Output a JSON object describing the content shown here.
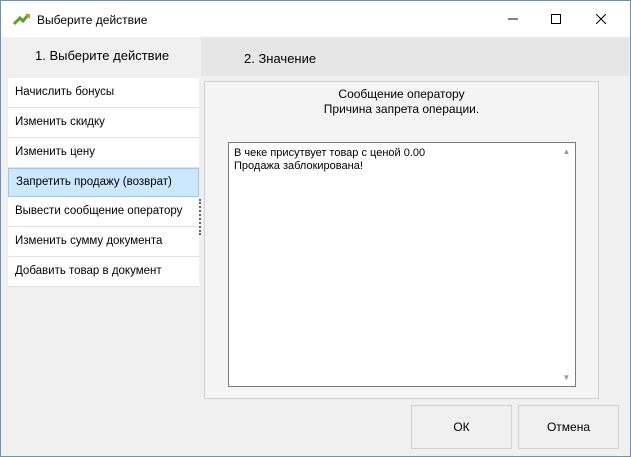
{
  "window": {
    "title": "Выберите действие"
  },
  "steps": {
    "step1_label": "1. Выберите  действие",
    "step2_label": "2. Значение"
  },
  "actions": [
    {
      "label": "Начислить бонусы"
    },
    {
      "label": "Изменить скидку"
    },
    {
      "label": "Изменить цену"
    },
    {
      "label": "Запретить продажу (возврат)",
      "selected": true
    },
    {
      "label": "Вывести сообщение оператору"
    },
    {
      "label": "Изменить сумму документа"
    },
    {
      "label": "Добавить товар в документ"
    }
  ],
  "panel": {
    "title_line1": "Сообщение оператору",
    "title_line2": "Причина запрета операции.",
    "message_text": "В чеке присутвует товар с ценой 0.00\nПродажа заблокирована!"
  },
  "buttons": {
    "ok": "ОК",
    "cancel": "Отмена"
  },
  "colors": {
    "selected_bg": "#cce8ff",
    "selected_border": "#99c9ef",
    "icon_green": "#5aa02c",
    "icon_orange": "#e08a1e"
  }
}
